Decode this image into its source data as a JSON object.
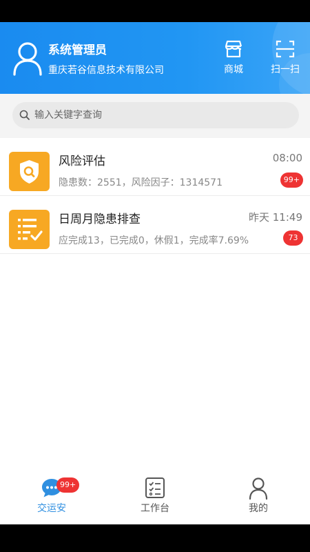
{
  "header": {
    "user_name": "系统管理员",
    "org_name": "重庆若谷信息技术有限公司",
    "shop_label": "商城",
    "scan_label": "扫一扫"
  },
  "search": {
    "placeholder": "输入关键字查询"
  },
  "messages": [
    {
      "title": "风险评估",
      "time": "08:00",
      "subtitle": "隐患数：2551，风险因子：1314571",
      "badge": "99+",
      "icon": "shield-search-icon"
    },
    {
      "title": "日周月隐患排查",
      "time": "昨天 11:49",
      "subtitle": "应完成13，已完成0，休假1，完成率7.69%",
      "badge": "73",
      "icon": "checklist-icon"
    }
  ],
  "tabbar": {
    "tabs": [
      {
        "label": "交运安",
        "badge": "99+",
        "icon": "chat-icon",
        "active": true
      },
      {
        "label": "工作台",
        "icon": "checklist-icon",
        "active": false
      },
      {
        "label": "我的",
        "icon": "person-icon",
        "active": false
      }
    ]
  },
  "colors": {
    "header_blue": "#2196f3",
    "icon_orange": "#f7a823",
    "badge_red": "#ee3333",
    "active_tab": "#2f8fe0",
    "inactive_tab": "#555555"
  }
}
